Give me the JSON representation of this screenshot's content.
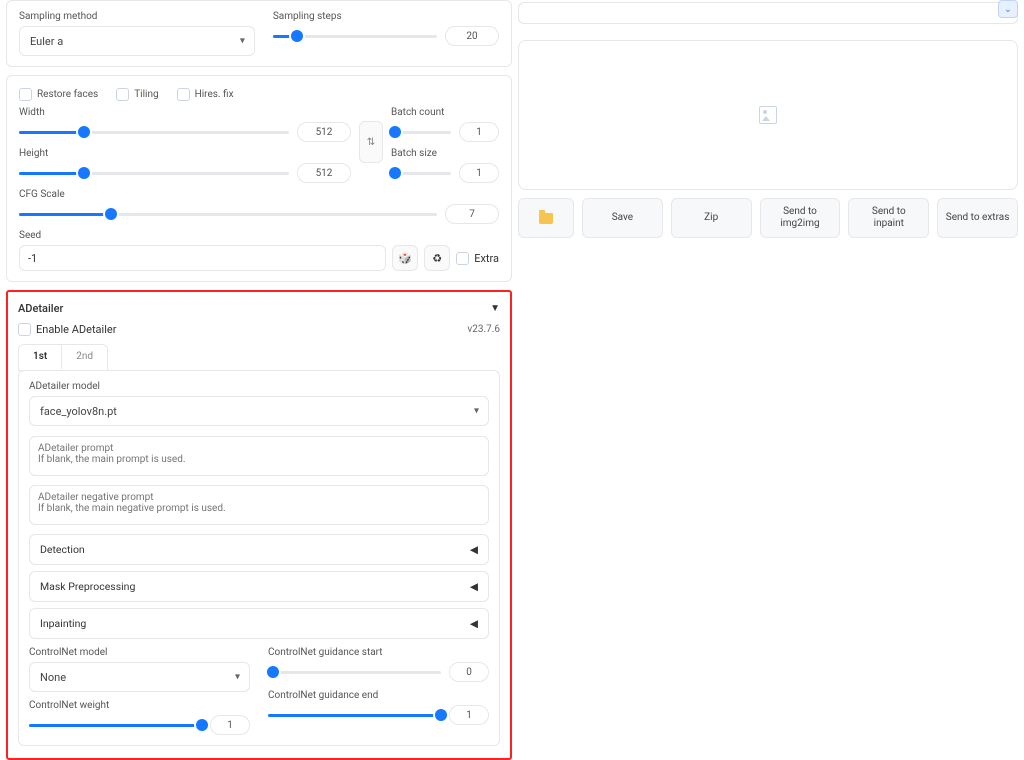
{
  "sampling": {
    "method_label": "Sampling method",
    "method_value": "Euler a",
    "steps_label": "Sampling steps",
    "steps_value": "20"
  },
  "checkboxes": {
    "restore_faces": "Restore faces",
    "tiling": "Tiling",
    "hires_fix": "Hires. fix"
  },
  "dims": {
    "width_label": "Width",
    "width_value": "512",
    "height_label": "Height",
    "height_value": "512"
  },
  "batch": {
    "count_label": "Batch count",
    "count_value": "1",
    "size_label": "Batch size",
    "size_value": "1"
  },
  "cfg": {
    "label": "CFG Scale",
    "value": "7"
  },
  "seed": {
    "label": "Seed",
    "value": "-1",
    "extra_label": "Extra"
  },
  "adetailer": {
    "title": "ADetailer",
    "enable_label": "Enable ADetailer",
    "version": "v23.7.6",
    "tabs": {
      "t1": "1st",
      "t2": "2nd"
    },
    "model_label": "ADetailer model",
    "model_value": "face_yolov8n.pt",
    "prompt_ph": "ADetailer prompt\nIf blank, the main prompt is used.",
    "neg_ph": "ADetailer negative prompt\nIf blank, the main negative prompt is used.",
    "acc1": "Detection",
    "acc2": "Mask Preprocessing",
    "acc3": "Inpainting",
    "cn_model_label": "ControlNet model",
    "cn_model_value": "None",
    "cn_weight_label": "ControlNet weight",
    "cn_weight_value": "1",
    "cn_gstart_label": "ControlNet guidance start",
    "cn_gstart_value": "0",
    "cn_gend_label": "ControlNet guidance end",
    "cn_gend_value": "1"
  },
  "buttons": {
    "save": "Save",
    "zip": "Zip",
    "send_img2img": "Send to\nimg2img",
    "send_inpaint": "Send to\ninpaint",
    "send_extras": "Send to extras"
  }
}
